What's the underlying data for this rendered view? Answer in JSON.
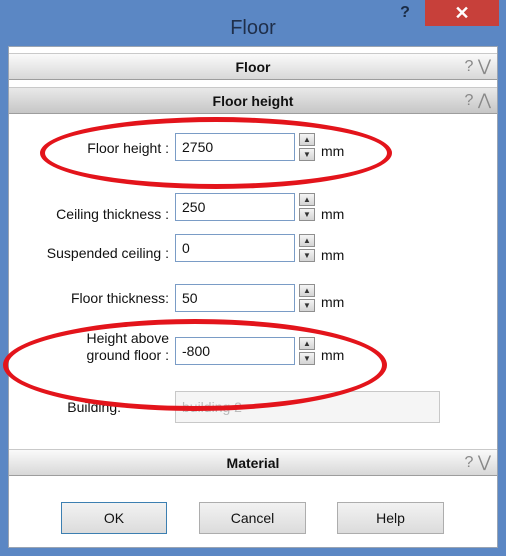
{
  "window": {
    "title": "Floor",
    "help_glyph": "?",
    "close_glyph": "✕"
  },
  "sections": {
    "floor": {
      "label": "Floor",
      "help": "?",
      "chevron": "⋁"
    },
    "floor_height": {
      "label": "Floor height",
      "help": "?",
      "chevron": "⋀"
    },
    "material": {
      "label": "Material",
      "help": "?",
      "chevron": "⋁"
    }
  },
  "fields": {
    "floor_height": {
      "label": "Floor height :",
      "value": "2750",
      "unit": "mm"
    },
    "ceiling_thickness": {
      "label": "Ceiling thickness :",
      "value": "250",
      "unit": "mm"
    },
    "suspended_ceiling": {
      "label": "Suspended ceiling :",
      "value": "0",
      "unit": "mm"
    },
    "floor_thickness": {
      "label": "Floor thickness:",
      "value": "50",
      "unit": "mm"
    },
    "height_above_ground": {
      "label_line1": "Height above",
      "label_line2": "ground floor :",
      "value": "-800",
      "unit": "mm"
    },
    "building": {
      "label": "Building:",
      "value": "building 2"
    }
  },
  "buttons": {
    "ok": "OK",
    "cancel": "Cancel",
    "help": "Help"
  },
  "colors": {
    "titlebar": "#5b87c4",
    "close": "#c7403a",
    "highlight_ring": "#e3141b"
  }
}
